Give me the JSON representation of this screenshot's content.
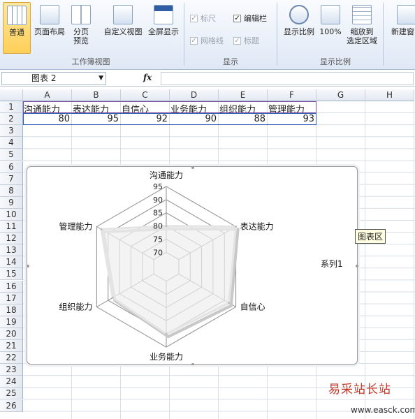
{
  "ribbon": {
    "workbook_views": {
      "normal": "普通",
      "page_layout": "页面布局",
      "page_break_1": "分页",
      "page_break_2": "预览",
      "custom_views": "自定义视图",
      "full_screen": "全屏显示",
      "group": "工作簿视图"
    },
    "show": {
      "ruler": "标尺",
      "formula_bar": "编辑栏",
      "gridlines": "网格线",
      "headings": "标题",
      "group": "显示"
    },
    "zoom": {
      "zoom": "显示比例",
      "zoom_100": "100%",
      "zoom_sel_1": "缩放到",
      "zoom_sel_2": "选定区域",
      "group": "显示比例"
    },
    "window": {
      "new_window": "新建窗口"
    }
  },
  "formula_bar": {
    "name_box": "图表 2",
    "fx": "fx",
    "formula": ""
  },
  "columns": [
    "A",
    "B",
    "C",
    "D",
    "E",
    "F",
    "G",
    "H"
  ],
  "rows": [
    "1",
    "2",
    "3",
    "4",
    "5",
    "6",
    "7",
    "8",
    "9",
    "10",
    "11",
    "12",
    "13",
    "14",
    "15",
    "16",
    "17",
    "18",
    "19",
    "20",
    "21",
    "22",
    "23",
    "24",
    "25",
    "26"
  ],
  "table": {
    "headers": [
      "沟通能力",
      "表达能力",
      "自信心",
      "业务能力",
      "组织能力",
      "管理能力"
    ],
    "values": [
      "80",
      "95",
      "92",
      "90",
      "88",
      "93"
    ]
  },
  "chart_data": {
    "type": "radar",
    "categories": [
      "沟通能力",
      "表达能力",
      "自信心",
      "业务能力",
      "组织能力",
      "管理能力"
    ],
    "series": [
      {
        "name": "系列1",
        "values": [
          80,
          95,
          92,
          90,
          88,
          93
        ]
      }
    ],
    "ylim": [
      70,
      95
    ],
    "ticks": [
      "70",
      "75",
      "80",
      "85",
      "90",
      "95"
    ],
    "legend": "right"
  },
  "tooltip": "图表区",
  "watermark": {
    "text": "易采站长站",
    "url": "www.easck.com"
  }
}
